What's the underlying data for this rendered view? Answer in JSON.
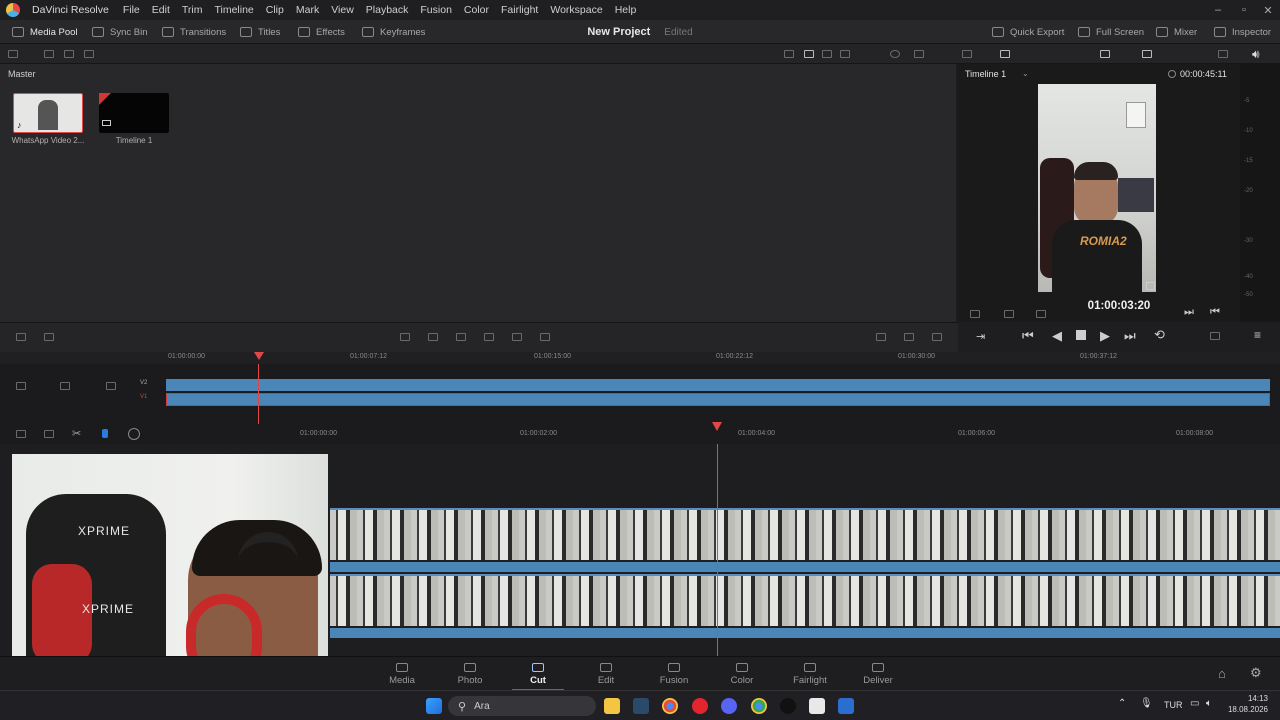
{
  "app": {
    "name": "DaVinci Resolve"
  },
  "menu": [
    "File",
    "Edit",
    "Trim",
    "Timeline",
    "Clip",
    "Mark",
    "View",
    "Playback",
    "Fusion",
    "Color",
    "Fairlight",
    "Workspace",
    "Help"
  ],
  "toolbar": {
    "media_pool": "Media Pool",
    "sync_bin": "Sync Bin",
    "transitions": "Transitions",
    "titles": "Titles",
    "effects": "Effects",
    "keyframes": "Keyframes",
    "quick_export": "Quick Export",
    "full_screen": "Full Screen",
    "mixer": "Mixer",
    "inspector": "Inspector"
  },
  "project": {
    "title": "New Project",
    "status": "Edited"
  },
  "bin": {
    "name": "Master"
  },
  "clips": [
    {
      "label": "WhatsApp Video 2...",
      "selected": true
    },
    {
      "label": "Timeline 1",
      "selected": false
    }
  ],
  "viewer": {
    "timeline_name": "Timeline 1",
    "duration": "00:00:45:11",
    "timecode": "01:00:03:20"
  },
  "meter_ticks": [
    "-5",
    "-10",
    "-15",
    "-20",
    "-30",
    "-40",
    "-50"
  ],
  "ruler_upper": [
    "01:00:00:00",
    "01:00:07:12",
    "01:00:15:00",
    "01:00:22:12",
    "01:00:30:00",
    "01:00:37:12"
  ],
  "ruler_lower": [
    "01:00:00:00",
    "01:00:02:00",
    "01:00:04:00",
    "01:00:06:00",
    "01:00:08:00"
  ],
  "tracks": {
    "v2": "V2",
    "v1": "V1"
  },
  "pages": [
    "Media",
    "Photo",
    "Cut",
    "Edit",
    "Fusion",
    "Color",
    "Fairlight",
    "Deliver"
  ],
  "active_page": "Cut",
  "webcam_text": {
    "top": "XPRIME",
    "bottom": "XPRIME"
  },
  "taskbar": {
    "search_placeholder": "Ara",
    "lang": "TUR",
    "time": "14:13",
    "date": "18.08.2026"
  },
  "colors": {
    "accent_red": "#d23b3b",
    "track_blue": "#4a86b8"
  }
}
